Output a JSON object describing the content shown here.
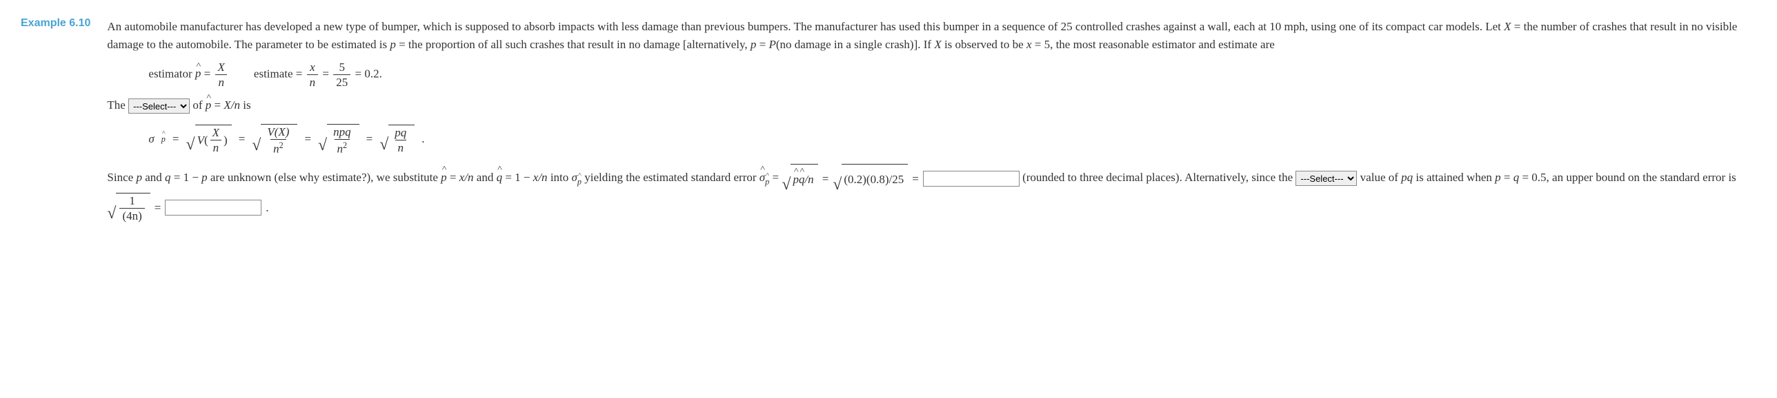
{
  "example_label": "Example 6.10",
  "intro": {
    "s1": "An automobile manufacturer has developed a new type of bumper, which is supposed to absorb impacts with less damage than previous bumpers. The manufacturer has used this bumper in a sequence of 25 controlled crashes against a wall, each at 10 mph, using one of its compact car models. Let ",
    "X": "X",
    "s2": " = the number of crashes that result in no visible damage to the automobile. The parameter to be estimated is ",
    "p": "p",
    "s3": " = the proportion of all such crashes that result in no damage [alternatively, ",
    "s4": " = ",
    "Pexpr": "P",
    "s5": "(no damage in a single crash)]. If ",
    "s6": " is observed to be ",
    "x": "x",
    "s7": " = 5, the most reasonable estimator and estimate are"
  },
  "formula1": {
    "est_label": "estimator ",
    "phat": "p",
    "eq": " = ",
    "X_over_n_num": "X",
    "X_over_n_den": "n",
    "estimate_label": "estimate = ",
    "x_over_n_num": "x",
    "x_over_n_den": "n",
    "five": "5",
    "twentyfive": "25",
    "val": " = 0.2."
  },
  "line2": {
    "the": "The ",
    "of": " of ",
    "phat": "p",
    "eq": " = ",
    "expr": "X/n",
    "is": " is"
  },
  "sigma_line": {
    "sigma": "σ",
    "phat_sub": "p̂",
    "eq": " = ",
    "V": "V",
    "X": "X",
    "n": "n",
    "VX": "V(X)",
    "n2": "n",
    "npq": "npq",
    "pq": "pq",
    "dot": "."
  },
  "para3": {
    "s1": "Since ",
    "p": "p",
    "s2": " and ",
    "q": "q",
    "s3": " = 1 − ",
    "s4": " are unknown (else why estimate?), we substitute ",
    "phat": "p",
    "s5": " = ",
    "xn": "x/n",
    "s6": " and ",
    "qhat": "q",
    "s7": " = 1 − ",
    "s8": " into ",
    "sigma": "σ",
    "s9": " yielding the estimated standard error ",
    "sigmahat": "σ",
    "s10": " = ",
    "root_pqn_label_p": "p",
    "root_pqn_label_q": "q",
    "root_pqn_label_n": "/n",
    "eq": " = ",
    "root_num": "(0.2)(0.8)/25",
    "eq2": " = ",
    "s11": " (rounded to three decimal places). Alternatively, since the ",
    "s12": " value of ",
    "pq": "pq",
    "s13": " is attained when ",
    "s14": " = ",
    "s15": " = 0.5, an upper bound on the standard error is ",
    "one": "1",
    "four_n": "(4n)",
    "period": "."
  },
  "select_placeholder": "---Select---",
  "chart_data": {
    "type": "table",
    "n": 25,
    "x": 5,
    "p_hat": 0.2,
    "q_hat": 0.8,
    "std_err_formula": "sqrt(p_hat*q_hat/n)",
    "upper_bound_formula": "sqrt(1/(4n))"
  }
}
